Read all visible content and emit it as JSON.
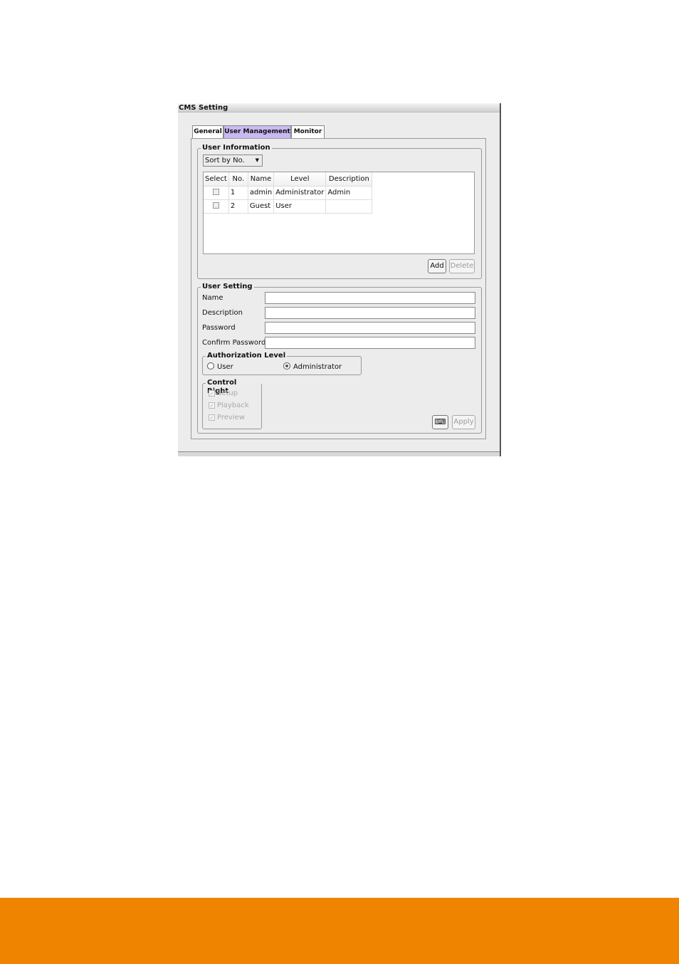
{
  "window": {
    "title": "CMS Setting"
  },
  "tabs": [
    {
      "label": "General"
    },
    {
      "label": "User Management",
      "active": true
    },
    {
      "label": "Monitor"
    }
  ],
  "user_information": {
    "legend": "User Information",
    "sort_select": {
      "value": "Sort by No."
    },
    "columns": [
      "Select",
      "No.",
      "Name",
      "Level",
      "Description"
    ],
    "rows": [
      {
        "selected": false,
        "no": "1",
        "name": "admin",
        "level": "Administrator",
        "description": "Admin"
      },
      {
        "selected": false,
        "no": "2",
        "name": "Guest",
        "level": "User",
        "description": ""
      }
    ],
    "add_label": "Add",
    "delete_label": "Delete"
  },
  "user_setting": {
    "legend": "User Setting",
    "fields": [
      {
        "label": "Name",
        "value": ""
      },
      {
        "label": "Description",
        "value": ""
      },
      {
        "label": "Password",
        "value": ""
      },
      {
        "label": "Confirm Password",
        "value": ""
      }
    ],
    "authorization": {
      "legend": "Authorization Level",
      "options": [
        {
          "label": "User",
          "selected": false
        },
        {
          "label": "Administrator",
          "selected": true
        }
      ]
    },
    "control_right": {
      "legend": "Control Right",
      "items": [
        {
          "label": "Setup",
          "checked": true
        },
        {
          "label": "Playback",
          "checked": true
        },
        {
          "label": "Preview",
          "checked": true
        }
      ]
    },
    "keyboard_icon": "keyboard-icon",
    "apply_label": "Apply"
  },
  "colors": {
    "active_tab": "#c9b9f2",
    "footer": "#ee8400"
  }
}
